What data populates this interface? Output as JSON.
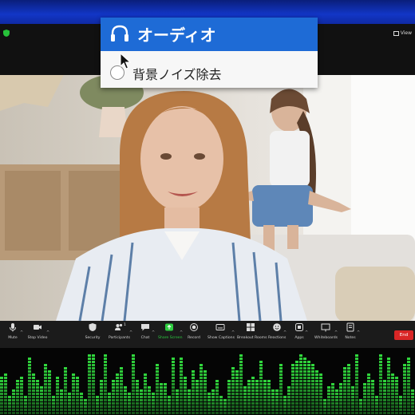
{
  "audio_menu": {
    "title": "オーディオ",
    "option_label": "背景ノイズ除去",
    "option_selected": false
  },
  "window": {
    "view_label": "View"
  },
  "toolbar": {
    "mute": "Mute",
    "stop_video": "Stop Video",
    "security": "Security",
    "participants": "Participants",
    "participants_count": "1",
    "chat": "Chat",
    "share_screen": "Share Screen",
    "record": "Record",
    "show_captions": "Show Captions",
    "breakout_rooms": "Breakout Rooms",
    "reactions": "Reactions",
    "apps": "Apps",
    "whiteboards": "Whiteboards",
    "notes": "Notes",
    "end": "End"
  },
  "colors": {
    "menu_header": "#1e6bd6",
    "share_green": "#2ecc40",
    "end_red": "#d92626",
    "meter_green": "#33e040"
  }
}
